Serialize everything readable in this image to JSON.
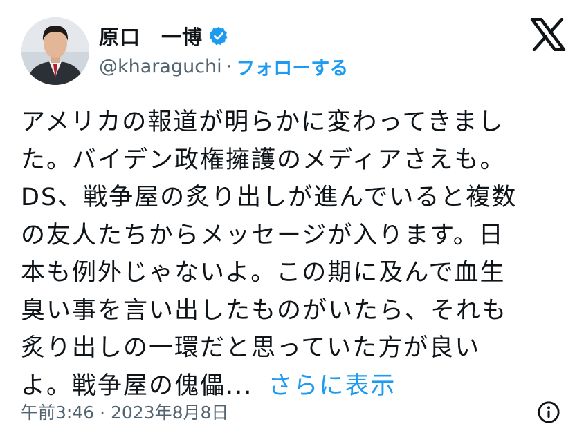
{
  "author": {
    "name": "原口　一博",
    "handle": "@kharaguchi",
    "separator": "·",
    "follow_label": "フォローする",
    "verified_icon": "verified-badge-icon",
    "verified_color": "#1d9bf0"
  },
  "brand": {
    "logo_icon": "x-logo-icon"
  },
  "tweet": {
    "lines": [
      "アメリカの報道が明らかに変わってきまし",
      "た。バイデン政権擁護のメディアさえも。",
      "DS、戦争屋の炙り出しが進んでいると複数",
      "の友人たちからメッセージが入ります。日",
      "本も例外じゃないよ。この期に及んで血生",
      "臭い事を言い出したものがいたら、それも",
      "炙り出しの一環だと思っていた方が良い",
      "よ。戦争屋の傀儡..."
    ],
    "show_more_label": "さらに表示"
  },
  "footer": {
    "timestamp": "午前3:46 · 2023年8月8日",
    "info_icon": "info-icon"
  },
  "colors": {
    "link": "#1d9bf0",
    "text": "#0f1419",
    "secondary": "#536471"
  }
}
